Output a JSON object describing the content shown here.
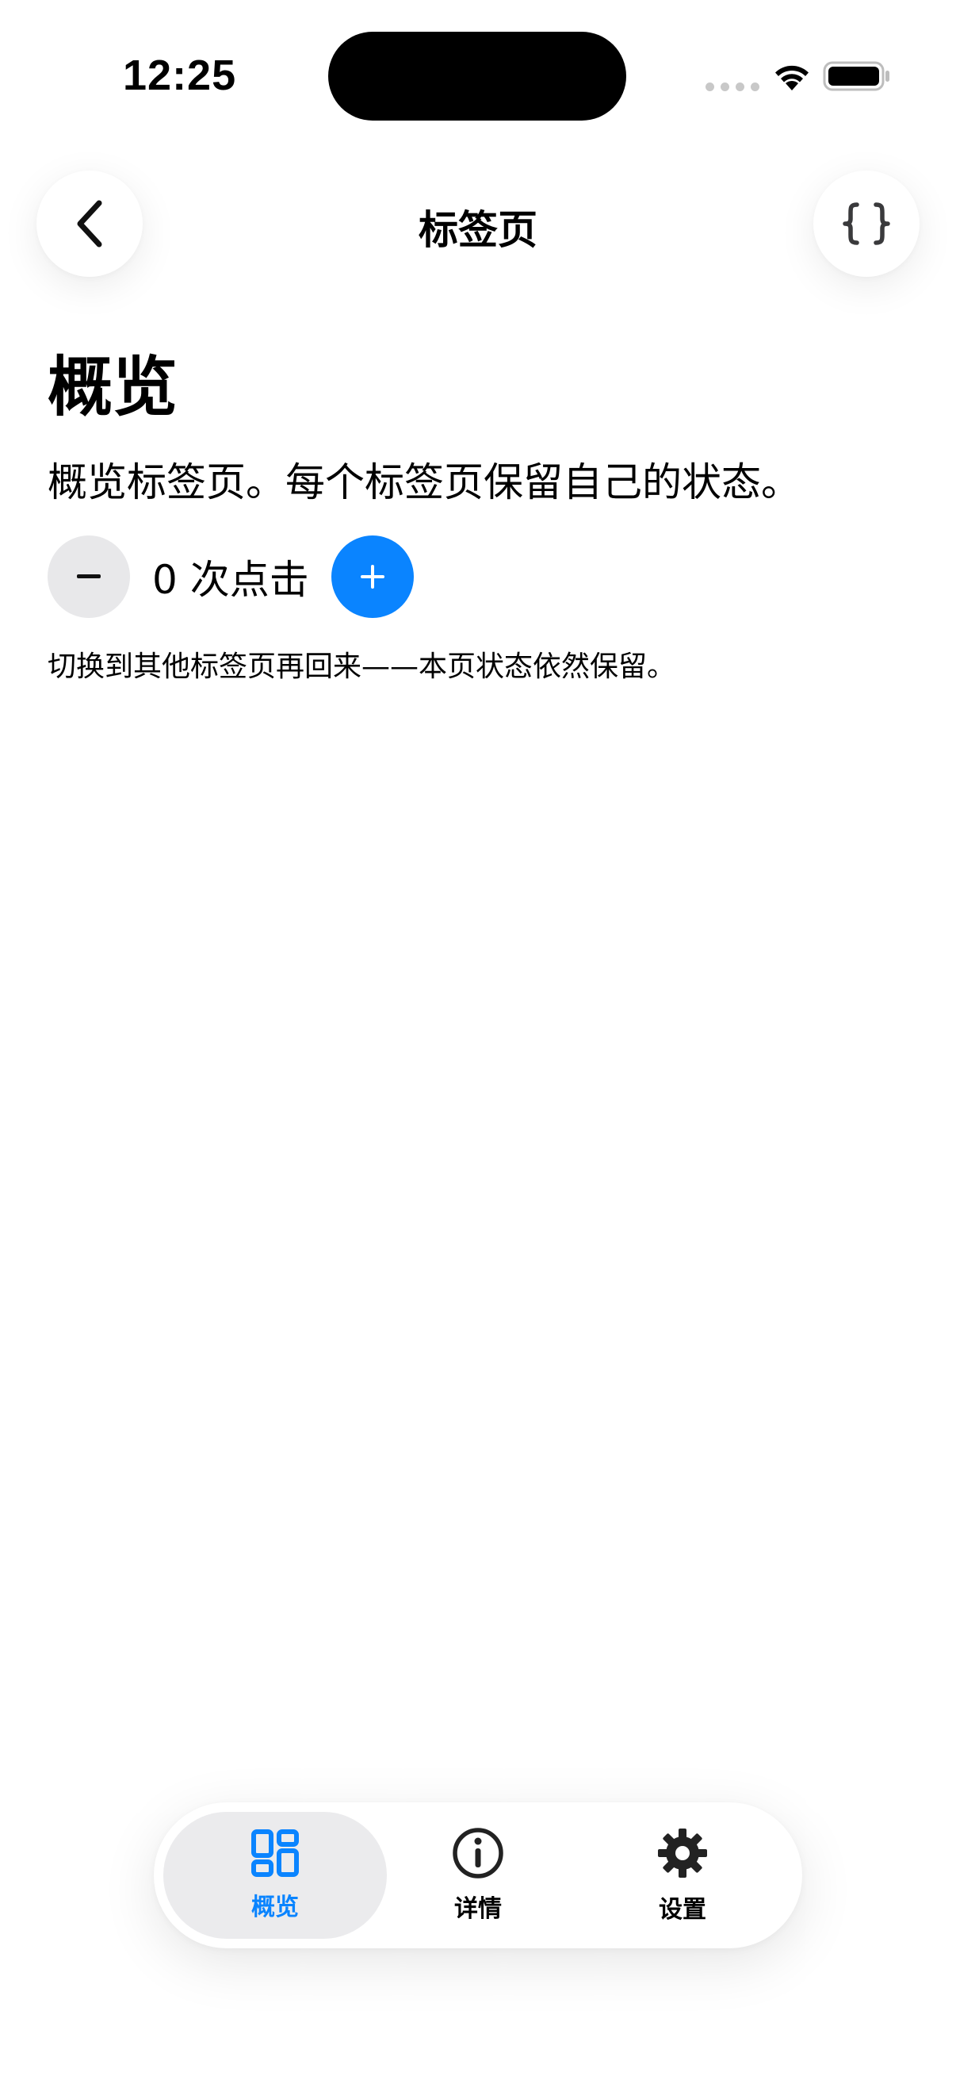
{
  "status_bar": {
    "time": "12:25"
  },
  "nav": {
    "title": "标签页",
    "back_icon": "chevron-left-icon",
    "action_icon": "curly-braces-icon"
  },
  "content": {
    "heading": "概览",
    "description": "概览标签页。每个标签页保留自己的状态。",
    "counter_text": "0 次点击",
    "minus_label": "−",
    "plus_label": "+",
    "hint": "切换到其他标签页再回来——本页状态依然保留。"
  },
  "tab_bar": {
    "tabs": [
      {
        "label": "概览",
        "icon": "grid-icon",
        "active": true
      },
      {
        "label": "详情",
        "icon": "info-icon",
        "active": false
      },
      {
        "label": "设置",
        "icon": "gear-icon",
        "active": false
      }
    ]
  },
  "colors": {
    "accent": "#0a84ff",
    "button_gray": "#e8e8ea",
    "active_tab_bg": "#ebebed"
  }
}
